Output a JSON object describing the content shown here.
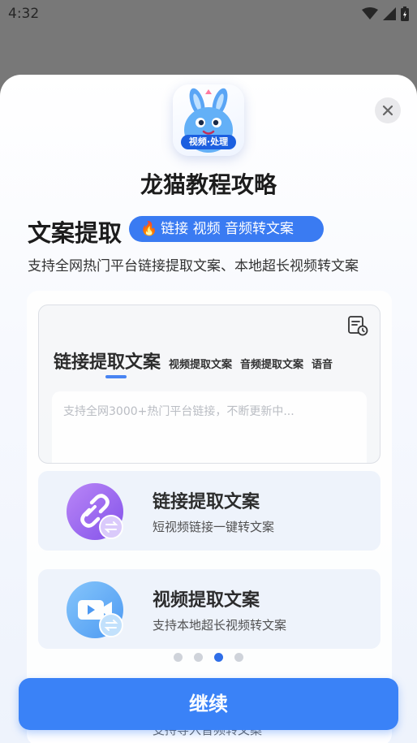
{
  "status_bar": {
    "time": "4:32"
  },
  "app": {
    "name": "龙猫教程攻略",
    "icon_badge": "视频·处理"
  },
  "section": {
    "title": "文案提取",
    "tag_icon": "fire-icon",
    "tag": "链接 视频 音频转文案",
    "subtitle": "支持全网热门平台链接提取文案、本地超长视频转文案"
  },
  "preview": {
    "active_tab": "链接提取文案",
    "tabs": [
      "视频提取文案",
      "音频提取文案",
      "语音"
    ],
    "input_placeholder": "支持全网3000+热门平台链接，不断更新中..."
  },
  "features": [
    {
      "icon": "link-icon",
      "title": "链接提取文案",
      "desc": "短视频链接一键转文案"
    },
    {
      "icon": "video-icon",
      "title": "视频提取文案",
      "desc": "支持本地超长视频转文案"
    }
  ],
  "peek_desc": "支持导入音频转文案",
  "pagination": {
    "count": 4,
    "active_index": 2
  },
  "continue_label": "继续",
  "colors": {
    "accent": "#3a82f7",
    "tag_bg": "#3a7bf2"
  }
}
